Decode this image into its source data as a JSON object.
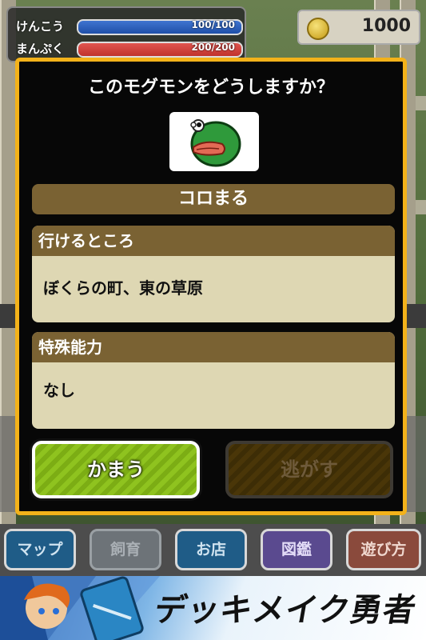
{
  "status": {
    "health_label": "けんこう",
    "health_value": "100/100",
    "health_fill": 1.0,
    "hunger_label": "まんぷく",
    "hunger_value": "200/200",
    "hunger_fill": 1.0
  },
  "coins": {
    "amount": "1000"
  },
  "dialog": {
    "title": "このモグモンをどうしますか？",
    "creature_name": "コロまる",
    "locations_header": "行けるところ",
    "locations_value": "ぼくらの町、東の草原",
    "ability_header": "特殊能力",
    "ability_value": "なし",
    "keep_label": "かまう",
    "release_label": "逃がす"
  },
  "nav": {
    "map": "マップ",
    "breeding": "飼育",
    "shop": "お店",
    "encyclopedia": "図鑑",
    "howto": "遊び方"
  },
  "banner": {
    "title": "デッキメイク勇者"
  },
  "colors": {
    "modal_border": "#f3b21a",
    "section_header": "#7a6233",
    "section_body": "#ded7b3",
    "keep_button": "#8fc31f",
    "health_bar": "#1f4fa8",
    "hunger_bar": "#c0322d"
  },
  "icons": {
    "coin": "coin-icon",
    "creature": "green-creature-icon"
  }
}
